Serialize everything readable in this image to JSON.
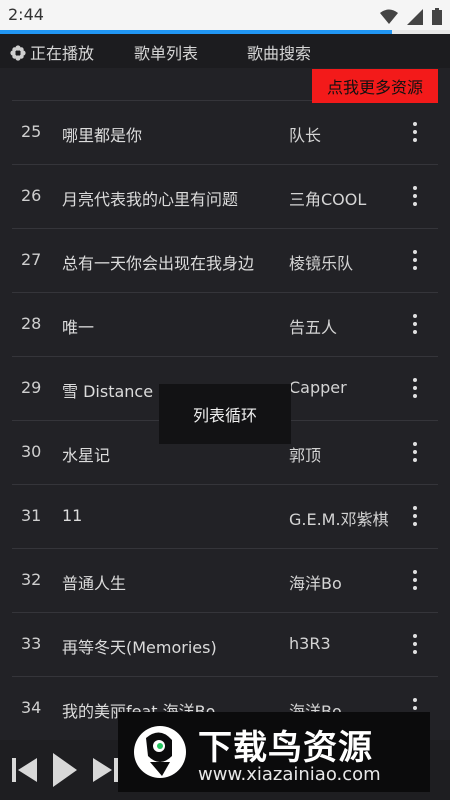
{
  "status_bar": {
    "time": "2:44",
    "icons": [
      "wifi-icon",
      "signal-icon",
      "battery-icon"
    ]
  },
  "playback_progress": 0.87,
  "tabs": [
    {
      "label": "正在播放",
      "icon": "gear-icon"
    },
    {
      "label": "歌单列表"
    },
    {
      "label": "歌曲搜索"
    }
  ],
  "more_resources_button": "点我更多资源",
  "songs": [
    {
      "num": "25",
      "title": "哪里都是你",
      "artist": "队长"
    },
    {
      "num": "26",
      "title": "月亮代表我的心里有问题",
      "artist": "三角COOL"
    },
    {
      "num": "27",
      "title": "总有一天你会出现在我身边",
      "artist": "棱镜乐队"
    },
    {
      "num": "28",
      "title": "唯一",
      "artist": "告五人"
    },
    {
      "num": "29",
      "title": "雪 Distance",
      "artist": "Capper"
    },
    {
      "num": "30",
      "title": "水星记",
      "artist": "郭顶"
    },
    {
      "num": "31",
      "title": "11",
      "artist": "G.E.M.邓紫棋"
    },
    {
      "num": "32",
      "title": "普通人生",
      "artist": "海洋Bo"
    },
    {
      "num": "33",
      "title": "再等冬天(Memories)",
      "artist": "h3R3"
    },
    {
      "num": "34",
      "title": "我的美丽feat.海洋Bo",
      "artist": "海洋Bo"
    }
  ],
  "toast": "列表循环",
  "player_controls": [
    "previous-icon",
    "play-icon",
    "next-icon"
  ],
  "watermark": {
    "title": "下载鸟资源",
    "url": "www.xiazainiao.com"
  },
  "colors": {
    "background": "#222226",
    "accent_progress": "#2196f3",
    "more_button": "#f31a1a"
  }
}
